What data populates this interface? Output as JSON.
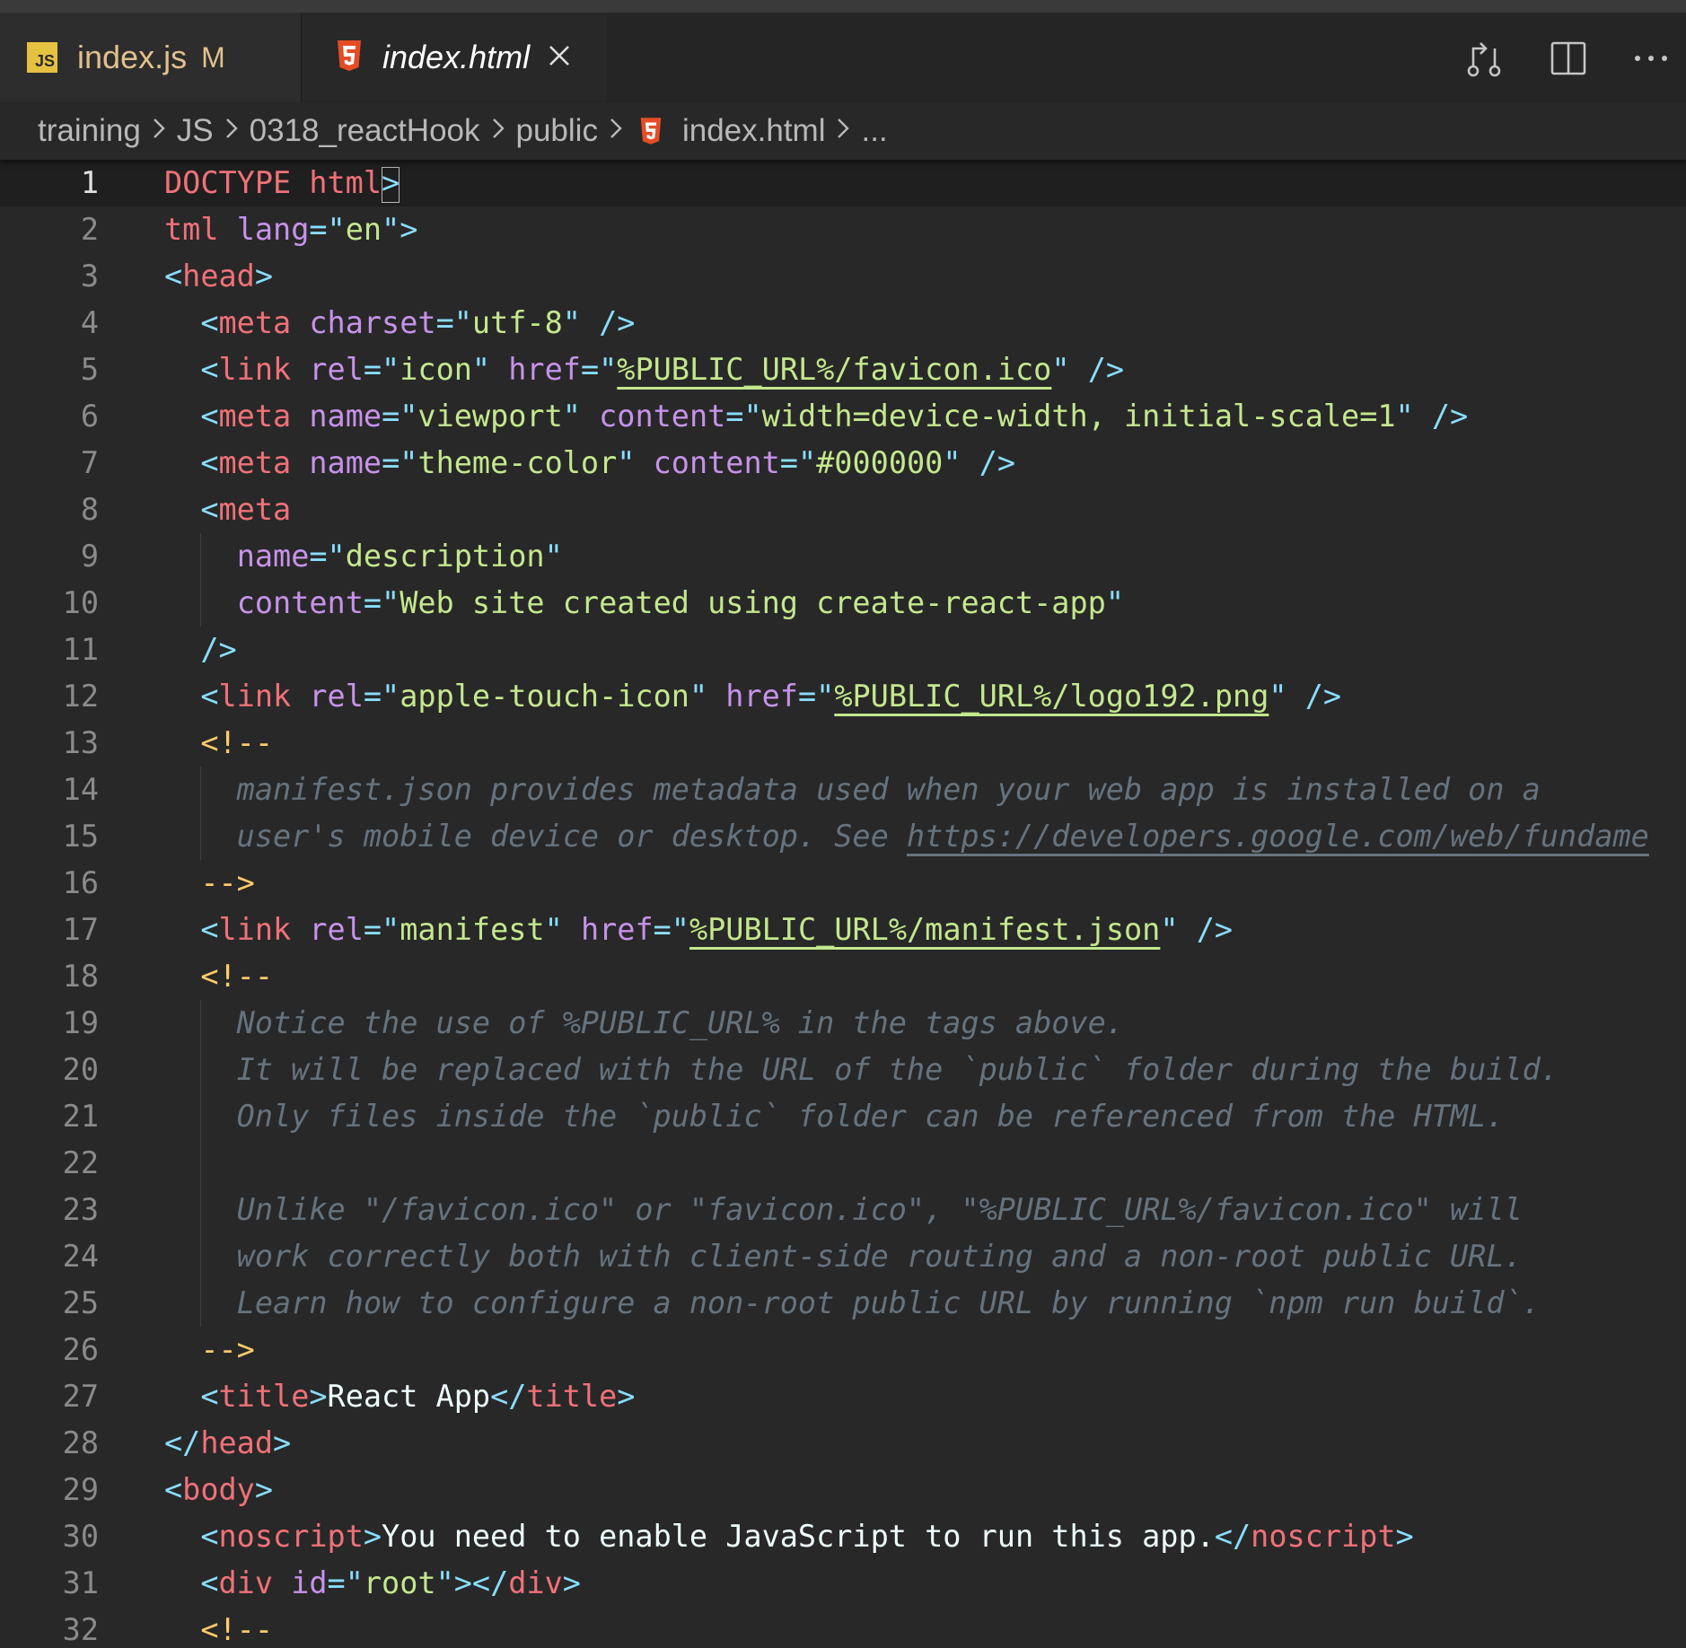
{
  "tabs": [
    {
      "label": "index.js",
      "status": "M",
      "icon": "js-file-icon"
    },
    {
      "label": "index.html",
      "icon": "html5-file-icon"
    }
  ],
  "actions": [
    "compare-changes-icon",
    "split-editor-icon",
    "more-actions-icon"
  ],
  "breadcrumb": [
    "training",
    "JS",
    "0318_reactHook",
    "public",
    "index.html",
    "..."
  ],
  "colors": {
    "background": "#282828",
    "tag": "#f07178",
    "punctuation": "#89ddff",
    "attribute": "#c792ea",
    "string": "#c3e88d",
    "comment": "#65737e",
    "comment_delimiter": "#ffcb6b"
  },
  "editor": {
    "lines": [
      {
        "n": "1",
        "tokens": [
          [
            "t",
            "DOCTYPE html"
          ],
          [
            "p",
            ">"
          ]
        ]
      },
      {
        "n": "2",
        "tokens": [
          [
            "t",
            "tml"
          ],
          [
            "txt",
            " "
          ],
          [
            "a",
            "lang"
          ],
          [
            "p",
            "=\""
          ],
          [
            "s",
            "en"
          ],
          [
            "p",
            "\">"
          ]
        ]
      },
      {
        "n": "3",
        "tokens": [
          [
            "p",
            "<"
          ],
          [
            "t",
            "head"
          ],
          [
            "p",
            ">"
          ]
        ]
      },
      {
        "n": "4",
        "tokens": [
          [
            "p",
            "  <"
          ],
          [
            "t",
            "meta"
          ],
          [
            "txt",
            " "
          ],
          [
            "a",
            "charset"
          ],
          [
            "p",
            "=\""
          ],
          [
            "s",
            "utf-8"
          ],
          [
            "p",
            "\" />"
          ]
        ]
      },
      {
        "n": "5",
        "tokens": [
          [
            "p",
            "  <"
          ],
          [
            "t",
            "link"
          ],
          [
            "txt",
            " "
          ],
          [
            "a",
            "rel"
          ],
          [
            "p",
            "=\""
          ],
          [
            "s",
            "icon"
          ],
          [
            "p",
            "\" "
          ],
          [
            "a",
            "href"
          ],
          [
            "p",
            "=\""
          ],
          [
            "sl",
            "%PUBLIC_URL%/favicon.ico"
          ],
          [
            "p",
            "\" />"
          ]
        ]
      },
      {
        "n": "6",
        "tokens": [
          [
            "p",
            "  <"
          ],
          [
            "t",
            "meta"
          ],
          [
            "txt",
            " "
          ],
          [
            "a",
            "name"
          ],
          [
            "p",
            "=\""
          ],
          [
            "s",
            "viewport"
          ],
          [
            "p",
            "\" "
          ],
          [
            "a",
            "content"
          ],
          [
            "p",
            "=\""
          ],
          [
            "s",
            "width=device-width, initial-scale=1"
          ],
          [
            "p",
            "\" />"
          ]
        ]
      },
      {
        "n": "7",
        "tokens": [
          [
            "p",
            "  <"
          ],
          [
            "t",
            "meta"
          ],
          [
            "txt",
            " "
          ],
          [
            "a",
            "name"
          ],
          [
            "p",
            "=\""
          ],
          [
            "s",
            "theme-color"
          ],
          [
            "p",
            "\" "
          ],
          [
            "a",
            "content"
          ],
          [
            "p",
            "=\""
          ],
          [
            "s",
            "#000000"
          ],
          [
            "p",
            "\" />"
          ]
        ]
      },
      {
        "n": "8",
        "tokens": [
          [
            "p",
            "  <"
          ],
          [
            "t",
            "meta"
          ]
        ]
      },
      {
        "n": "9",
        "tokens": [
          [
            "txt",
            "    "
          ],
          [
            "a",
            "name"
          ],
          [
            "p",
            "=\""
          ],
          [
            "s",
            "description"
          ],
          [
            "p",
            "\""
          ]
        ]
      },
      {
        "n": "10",
        "tokens": [
          [
            "txt",
            "    "
          ],
          [
            "a",
            "content"
          ],
          [
            "p",
            "=\""
          ],
          [
            "s",
            "Web site created using create-react-app"
          ],
          [
            "p",
            "\""
          ]
        ]
      },
      {
        "n": "11",
        "tokens": [
          [
            "p",
            "  />"
          ]
        ]
      },
      {
        "n": "12",
        "tokens": [
          [
            "p",
            "  <"
          ],
          [
            "t",
            "link"
          ],
          [
            "txt",
            " "
          ],
          [
            "a",
            "rel"
          ],
          [
            "p",
            "=\""
          ],
          [
            "s",
            "apple-touch-icon"
          ],
          [
            "p",
            "\" "
          ],
          [
            "a",
            "href"
          ],
          [
            "p",
            "=\""
          ],
          [
            "sl",
            "%PUBLIC_URL%/logo192.png"
          ],
          [
            "p",
            "\" />"
          ]
        ]
      },
      {
        "n": "13",
        "tokens": [
          [
            "cd",
            "  <!--"
          ]
        ]
      },
      {
        "n": "14",
        "tokens": [
          [
            "c",
            "    manifest.json provides metadata used when your web app is installed on a"
          ]
        ]
      },
      {
        "n": "15",
        "tokens": [
          [
            "c",
            "    user's mobile device or desktop. See "
          ],
          [
            "cl",
            "https://developers.google.com/web/fundame"
          ]
        ]
      },
      {
        "n": "16",
        "tokens": [
          [
            "cd",
            "  -->"
          ]
        ]
      },
      {
        "n": "17",
        "tokens": [
          [
            "p",
            "  <"
          ],
          [
            "t",
            "link"
          ],
          [
            "txt",
            " "
          ],
          [
            "a",
            "rel"
          ],
          [
            "p",
            "=\""
          ],
          [
            "s",
            "manifest"
          ],
          [
            "p",
            "\" "
          ],
          [
            "a",
            "href"
          ],
          [
            "p",
            "=\""
          ],
          [
            "sl",
            "%PUBLIC_URL%/manifest.json"
          ],
          [
            "p",
            "\" />"
          ]
        ]
      },
      {
        "n": "18",
        "tokens": [
          [
            "cd",
            "  <!--"
          ]
        ]
      },
      {
        "n": "19",
        "tokens": [
          [
            "c",
            "    Notice the use of %PUBLIC_URL% in the tags above."
          ]
        ]
      },
      {
        "n": "20",
        "tokens": [
          [
            "c",
            "    It will be replaced with the URL of the `public` folder during the build."
          ]
        ]
      },
      {
        "n": "21",
        "tokens": [
          [
            "c",
            "    Only files inside the `public` folder can be referenced from the HTML."
          ]
        ]
      },
      {
        "n": "22",
        "tokens": []
      },
      {
        "n": "23",
        "tokens": [
          [
            "c",
            "    Unlike \"/favicon.ico\" or \"favicon.ico\", \"%PUBLIC_URL%/favicon.ico\" will"
          ]
        ]
      },
      {
        "n": "24",
        "tokens": [
          [
            "c",
            "    work correctly both with client-side routing and a non-root public URL."
          ]
        ]
      },
      {
        "n": "25",
        "tokens": [
          [
            "c",
            "    Learn how to configure a non-root public URL by running `npm run build`."
          ]
        ]
      },
      {
        "n": "26",
        "tokens": [
          [
            "cd",
            "  -->"
          ]
        ]
      },
      {
        "n": "27",
        "tokens": [
          [
            "p",
            "  <"
          ],
          [
            "t",
            "title"
          ],
          [
            "p",
            ">"
          ],
          [
            "txt",
            "React App"
          ],
          [
            "p",
            "</"
          ],
          [
            "t",
            "title"
          ],
          [
            "p",
            ">"
          ]
        ]
      },
      {
        "n": "28",
        "tokens": [
          [
            "p",
            "</"
          ],
          [
            "t",
            "head"
          ],
          [
            "p",
            ">"
          ]
        ]
      },
      {
        "n": "29",
        "tokens": [
          [
            "p",
            "<"
          ],
          [
            "t",
            "body"
          ],
          [
            "p",
            ">"
          ]
        ]
      },
      {
        "n": "30",
        "tokens": [
          [
            "p",
            "  <"
          ],
          [
            "t",
            "noscript"
          ],
          [
            "p",
            ">"
          ],
          [
            "txt",
            "You need to enable JavaScript to run this app."
          ],
          [
            "p",
            "</"
          ],
          [
            "t",
            "noscript"
          ],
          [
            "p",
            ">"
          ]
        ]
      },
      {
        "n": "31",
        "tokens": [
          [
            "p",
            "  <"
          ],
          [
            "t",
            "div"
          ],
          [
            "txt",
            " "
          ],
          [
            "a",
            "id"
          ],
          [
            "p",
            "=\""
          ],
          [
            "s",
            "root"
          ],
          [
            "p",
            "\"></"
          ],
          [
            "t",
            "div"
          ],
          [
            "p",
            ">"
          ]
        ]
      },
      {
        "n": "32",
        "tokens": [
          [
            "cd",
            "  <!--"
          ]
        ]
      }
    ]
  }
}
